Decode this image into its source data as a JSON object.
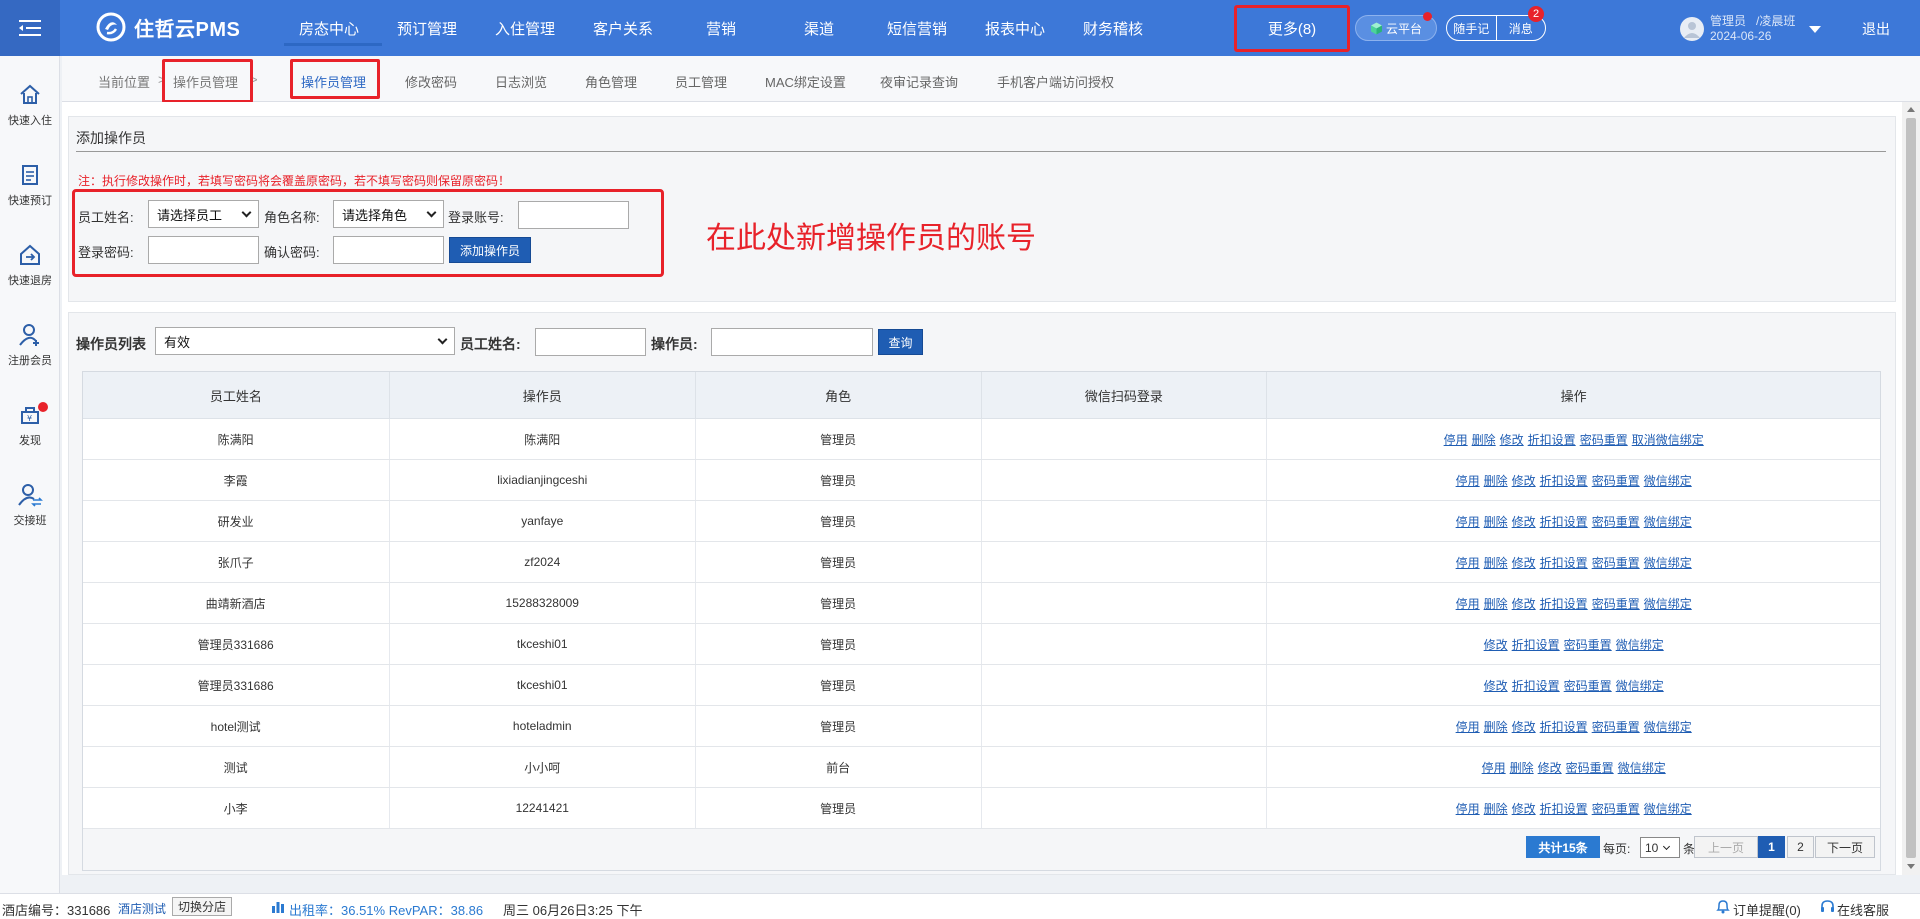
{
  "app": {
    "logo_text": "住哲云PMS"
  },
  "nav": {
    "items": [
      "房态中心",
      "预订管理",
      "入住管理",
      "客户关系",
      "营销",
      "渠道",
      "短信营销",
      "报表中心",
      "财务稽核"
    ],
    "more_label": "更多(8)"
  },
  "top_right": {
    "cloud_label": "云平台",
    "notes_label": "随手记",
    "messages_label": "消息",
    "messages_badge": "2",
    "user_role": "管理员",
    "user_shift": "/凌晨班",
    "user_date": "2024-06-26",
    "logout_label": "退出"
  },
  "sidebar": {
    "items": [
      "快速入住",
      "快速预订",
      "快速退房",
      "注册会员",
      "发现",
      "交接班"
    ]
  },
  "breadcrumb": {
    "prefix": "当前位置",
    "current": "操作员管理",
    "arrow": ">"
  },
  "tabs": [
    "操作员管理",
    "修改密码",
    "日志浏览",
    "角色管理",
    "员工管理",
    "MAC绑定设置",
    "夜审记录查询",
    "手机客户端访问授权"
  ],
  "add_form": {
    "title": "添加操作员",
    "note": "注：执行修改操作时，若填写密码将会覆盖原密码，若不填写密码则保留原密码！",
    "employee_label": "员工姓名:",
    "employee_select": "请选择员工",
    "role_label": "角色名称:",
    "role_select": "请选择角色",
    "account_label": "登录账号:",
    "password_label": "登录密码:",
    "confirm_label": "确认密码:",
    "add_button": "添加操作员",
    "annotation": "在此处新增操作员的账号"
  },
  "list_filter": {
    "list_label": "操作员列表",
    "status_select": "有效",
    "employee_label": "员工姓名:",
    "operator_label": "操作员:",
    "query_button": "查询"
  },
  "table": {
    "columns": [
      "员工姓名",
      "操作员",
      "角色",
      "微信扫码登录",
      "操作"
    ],
    "rows": [
      {
        "name": "陈满阳",
        "operator": "陈满阳",
        "role": "管理员",
        "wechat": "",
        "ops": [
          "停用",
          "删除",
          "修改",
          "折扣设置",
          "密码重置",
          "取消微信绑定"
        ]
      },
      {
        "name": "李霞",
        "operator": "lixiadianjingceshi",
        "role": "管理员",
        "wechat": "",
        "ops": [
          "停用",
          "删除",
          "修改",
          "折扣设置",
          "密码重置",
          "微信绑定"
        ]
      },
      {
        "name": "研发业",
        "operator": "yanfaye",
        "role": "管理员",
        "wechat": "",
        "ops": [
          "停用",
          "删除",
          "修改",
          "折扣设置",
          "密码重置",
          "微信绑定"
        ]
      },
      {
        "name": "张爪子",
        "operator": "zf2024",
        "role": "管理员",
        "wechat": "",
        "ops": [
          "停用",
          "删除",
          "修改",
          "折扣设置",
          "密码重置",
          "微信绑定"
        ]
      },
      {
        "name": "曲靖新酒店",
        "operator": "15288328009",
        "role": "管理员",
        "wechat": "",
        "ops": [
          "停用",
          "删除",
          "修改",
          "折扣设置",
          "密码重置",
          "微信绑定"
        ]
      },
      {
        "name": "管理员331686",
        "operator": "tkceshi01",
        "role": "管理员",
        "wechat": "",
        "ops": [
          "修改",
          "折扣设置",
          "密码重置",
          "微信绑定"
        ]
      },
      {
        "name": "管理员331686",
        "operator": "tkceshi01",
        "role": "管理员",
        "wechat": "",
        "ops": [
          "修改",
          "折扣设置",
          "密码重置",
          "微信绑定"
        ]
      },
      {
        "name": "hotel测试",
        "operator": "hoteladmin",
        "role": "管理员",
        "wechat": "",
        "ops": [
          "停用",
          "删除",
          "修改",
          "折扣设置",
          "密码重置",
          "微信绑定"
        ]
      },
      {
        "name": "测试",
        "operator": "小小呵",
        "role": "前台",
        "wechat": "",
        "ops": [
          "停用",
          "删除",
          "修改",
          "密码重置",
          "微信绑定"
        ]
      },
      {
        "name": "小李",
        "operator": "12241421",
        "role": "管理员",
        "wechat": "",
        "ops": [
          "停用",
          "删除",
          "修改",
          "折扣设置",
          "密码重置",
          "微信绑定"
        ]
      }
    ]
  },
  "pager": {
    "total": "共计15条",
    "per_page_label": "每页:",
    "per_page_value": "10",
    "unit": "条",
    "prev": "上一页",
    "pages": [
      "1",
      "2"
    ],
    "current_page": "1",
    "next": "下一页"
  },
  "statusbar": {
    "hotel_id_label": "酒店编号：331686",
    "hotel_name": "酒店测试",
    "switch_branch": "切换分店",
    "occupancy": "出租率：36.51% RevPAR：38.86",
    "datetime": "周三 06月26日3:25 下午",
    "order_reminder": "订单提醒(0)",
    "online_service": "在线客服"
  },
  "colors": {
    "topbar": "#3d78d8",
    "accent": "#1f5db3",
    "highlight": "#e8222a"
  }
}
